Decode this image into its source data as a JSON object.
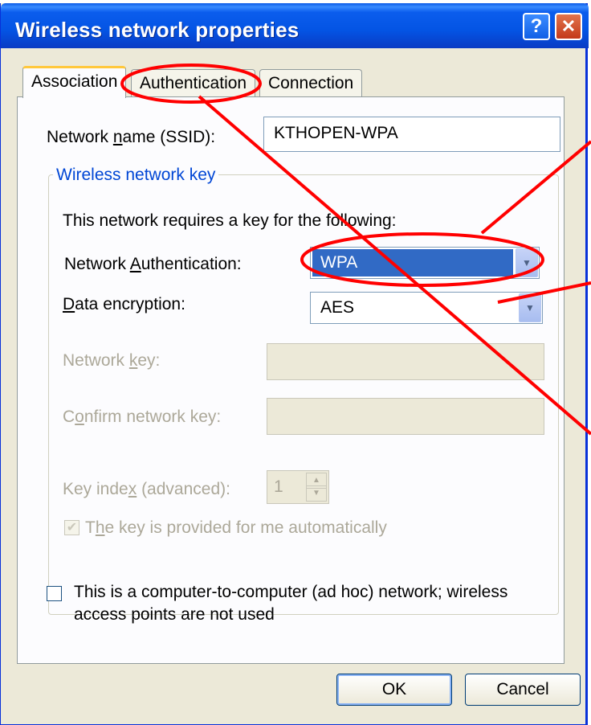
{
  "window": {
    "title": "Wireless network properties",
    "help_label": "?",
    "close_label": "✕"
  },
  "tabs": [
    {
      "label": "Association",
      "active": true
    },
    {
      "label": "Authentication",
      "active": false
    },
    {
      "label": "Connection",
      "active": false
    }
  ],
  "association": {
    "network_name": {
      "label": "Network name (SSID):",
      "underline": "n",
      "value": "KTHOPEN-WPA"
    },
    "wireless_key_group": {
      "legend": "Wireless network key",
      "requires_text": "This network requires a key for the following:",
      "network_authentication": {
        "label": "Network Authentication:",
        "underline": "A",
        "value": "WPA"
      },
      "data_encryption": {
        "label": "Data encryption:",
        "underline": "D",
        "value": "AES"
      },
      "network_key": {
        "label": "Network key:",
        "underline": "k",
        "value": ""
      },
      "confirm_key": {
        "label": "Confirm network key:",
        "underline": "o",
        "value": ""
      },
      "key_index": {
        "label": "Key index (advanced):",
        "underline": "x",
        "value": "1"
      },
      "auto_key": {
        "label": "The key is provided for me automatically",
        "underline": "h",
        "checked": true
      }
    },
    "adhoc": {
      "label_line1": "This is a computer-to-computer (ad hoc) network; wireless",
      "label_line2": "access points are not used",
      "checked": false
    }
  },
  "buttons": {
    "ok_label": "OK",
    "cancel_label": "Cancel"
  },
  "colors": {
    "titlebar_blue": "#0454e4",
    "dialog_face": "#ece9d8",
    "group_legend": "#0046d5",
    "selection": "#316ac5",
    "annotation_red": "#ff0000",
    "disabled_text": "#aca899"
  }
}
